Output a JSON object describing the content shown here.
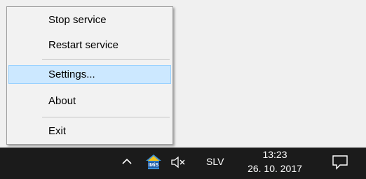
{
  "context_menu": {
    "items": [
      {
        "label": "Stop service"
      },
      {
        "label": "Restart service"
      },
      {
        "label": "Settings..."
      },
      {
        "label": "About"
      },
      {
        "label": "Exit"
      }
    ],
    "selected_index": 2
  },
  "taskbar": {
    "tray_icons": [
      "chevron-up-icon",
      "imis-app-icon",
      "volume-muted-icon"
    ],
    "language": "SLV",
    "time": "13:23",
    "date": "26. 10. 2017",
    "notification_icon": "action-center-icon"
  },
  "colors": {
    "menu_background": "#f2f2f2",
    "menu_highlight": "#cce8ff",
    "taskbar_background": "#1b1b1b"
  }
}
